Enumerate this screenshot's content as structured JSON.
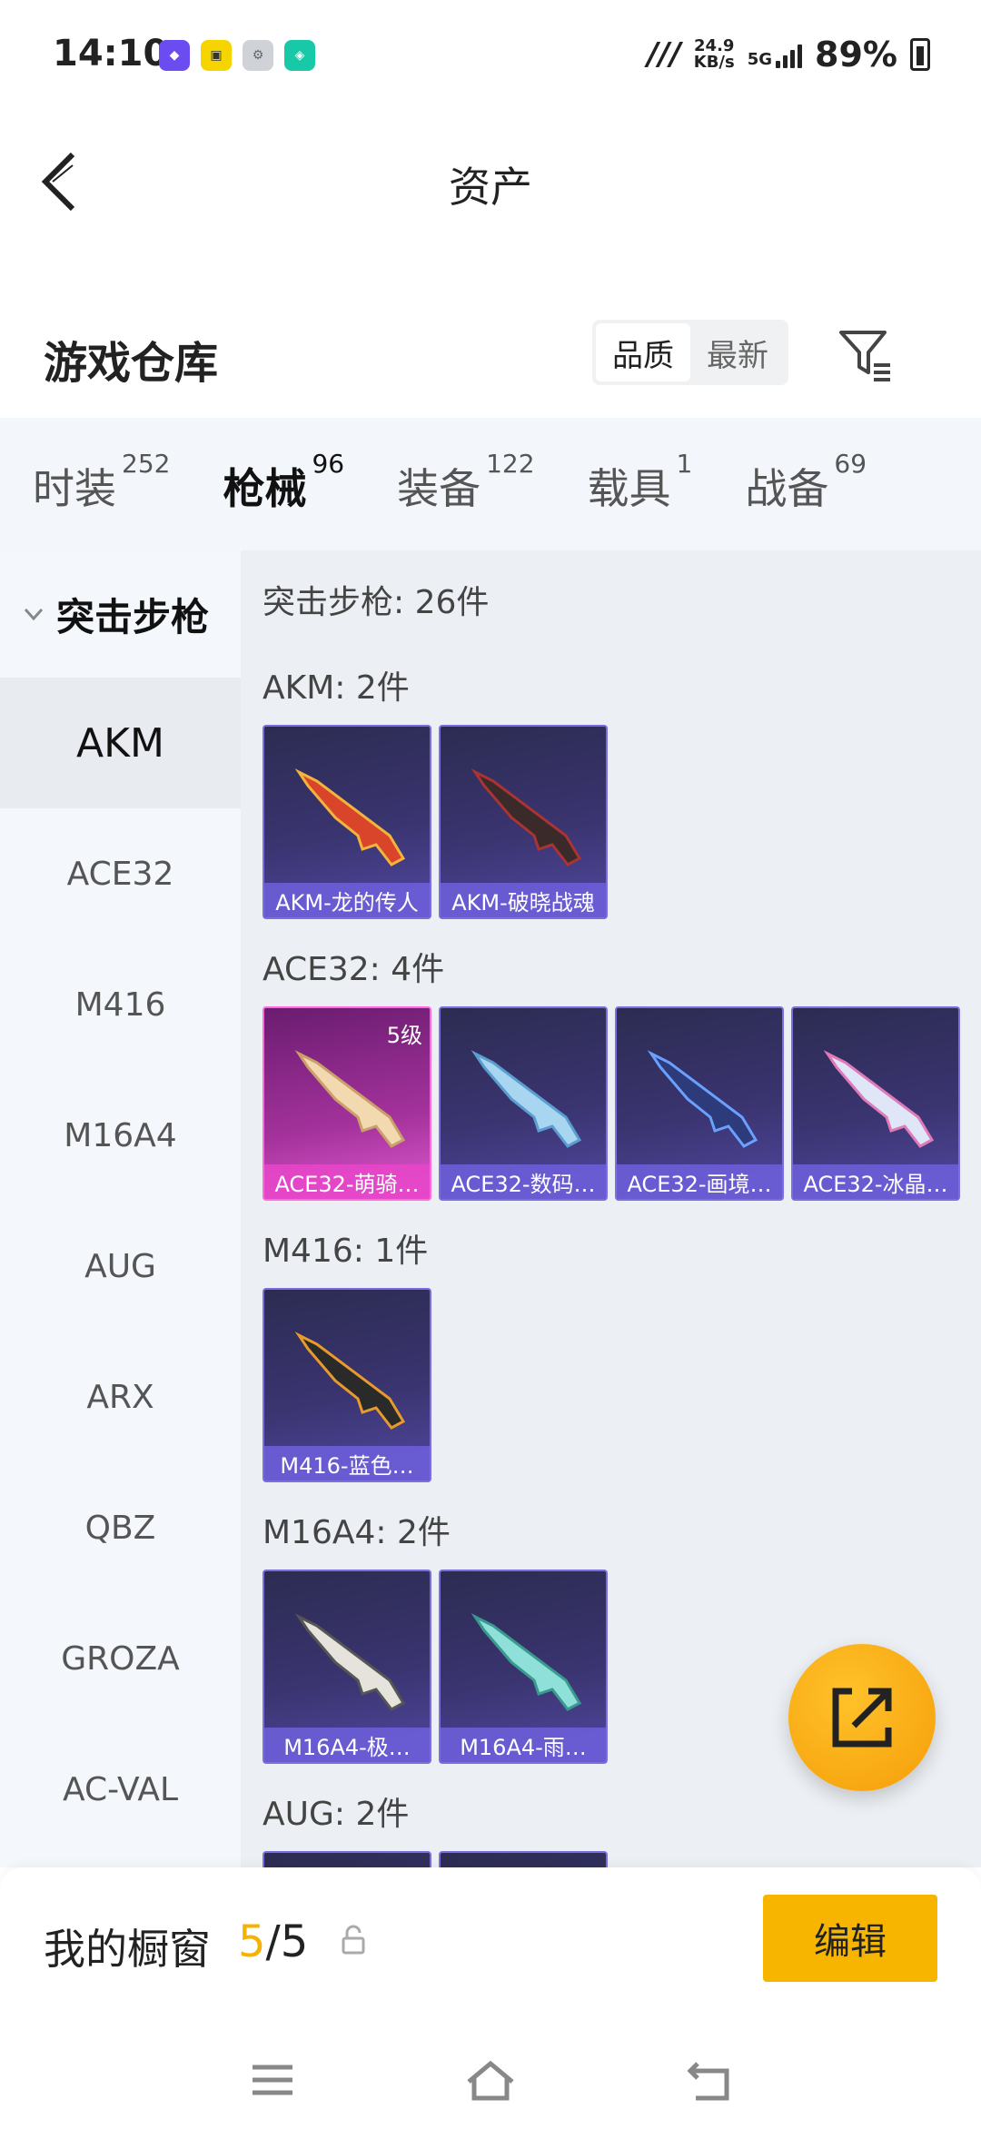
{
  "status_bar": {
    "time": "14:10",
    "net_speed": "24.9",
    "net_unit": "KB/s",
    "net_type": "5G",
    "battery": "89%"
  },
  "header": {
    "title": "资产"
  },
  "warehouse": {
    "title": "游戏仓库",
    "sort_quality": "品质",
    "sort_latest": "最新"
  },
  "tabs": [
    {
      "label": "时装",
      "count": "252"
    },
    {
      "label": "枪械",
      "count": "96"
    },
    {
      "label": "装备",
      "count": "122"
    },
    {
      "label": "载具",
      "count": "1"
    },
    {
      "label": "战备",
      "count": "69"
    }
  ],
  "sidebar": {
    "group": "突击步枪",
    "items": [
      "AKM",
      "ACE32",
      "M416",
      "M16A4",
      "AUG",
      "ARX",
      "QBZ",
      "GROZA",
      "AC-VAL"
    ]
  },
  "main": {
    "summary": "突击步枪: 26件",
    "sections": [
      {
        "title": "AKM: 2件",
        "items": [
          "AKM-龙的传人",
          "AKM-破晓战魂"
        ]
      },
      {
        "title": "ACE32: 4件",
        "items": [
          "ACE32-萌骑…",
          "ACE32-数码…",
          "ACE32-画境…",
          "ACE32-冰晶…"
        ],
        "level": "5级"
      },
      {
        "title": "M416: 1件",
        "items": [
          "M416-蓝色…"
        ]
      },
      {
        "title": "M16A4: 2件",
        "items": [
          "M16A4-极…",
          "M16A4-雨…"
        ]
      },
      {
        "title": "AUG: 2件",
        "items": []
      }
    ]
  },
  "showcase": {
    "label": "我的橱窗",
    "current": "5",
    "total": "/5",
    "edit": "编辑"
  },
  "colors": {
    "accent": "#f7b500",
    "card_purple": "#3a3470",
    "card_pink": "#a4329c"
  }
}
